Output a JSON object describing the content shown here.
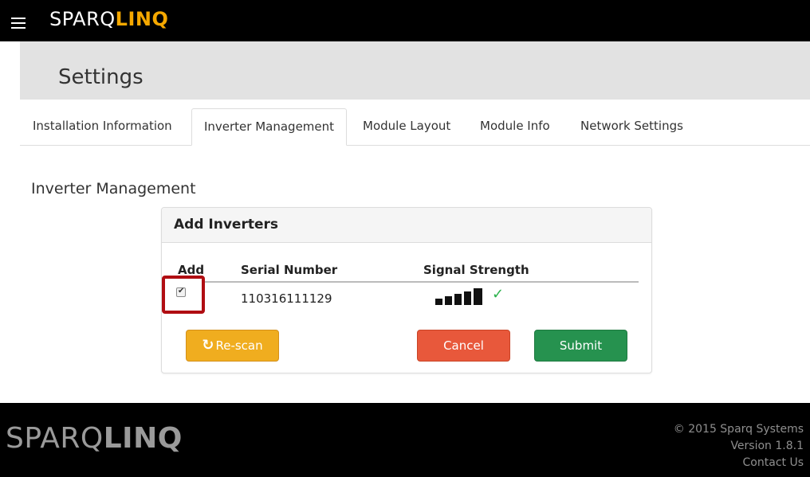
{
  "app": {
    "brand_light": "SPARQ",
    "brand_bold": "LINQ"
  },
  "settings": {
    "title": "Settings"
  },
  "tabs": [
    {
      "label": "Installation Information"
    },
    {
      "label": "Inverter Management"
    },
    {
      "label": "Module Layout"
    },
    {
      "label": "Module Info"
    },
    {
      "label": "Network Settings"
    }
  ],
  "section": {
    "title": "Inverter Management"
  },
  "panel": {
    "title": "Add Inverters",
    "columns": {
      "add": "Add",
      "serial": "Serial Number",
      "signal": "Signal Strength"
    },
    "rows": [
      {
        "checked": true,
        "serial": "110316111129",
        "signal_bars": 5,
        "signal_ok": true
      }
    ],
    "buttons": {
      "rescan": "Re-scan",
      "cancel": "Cancel",
      "submit": "Submit"
    }
  },
  "footer": {
    "brand_light": "SPARQ",
    "brand_bold": "LINQ",
    "copyright": "© 2015 Sparq Systems",
    "version": "Version 1.8.1",
    "contact": "Contact Us"
  },
  "colors": {
    "brand_accent": "#f5a800",
    "rescan": "#f0ad1f",
    "cancel": "#e8583b",
    "submit": "#26924f",
    "highlight": "#b00d12",
    "signal_ok": "#2bb24c"
  },
  "icons": {
    "menu": "hamburger-icon",
    "rescan": "refresh-icon",
    "signal_ok": "checkmark-icon"
  }
}
